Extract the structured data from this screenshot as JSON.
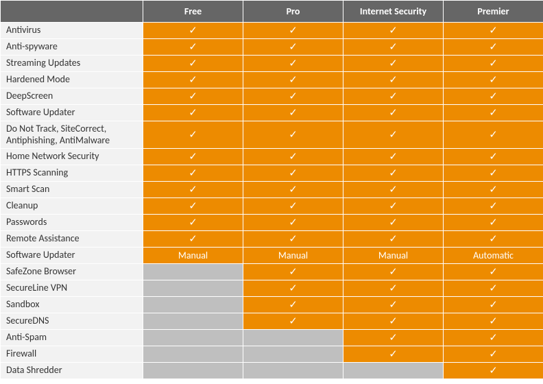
{
  "columns": [
    "Free",
    "Pro",
    "Internet Security",
    "Premier"
  ],
  "check_glyph": "✓",
  "manual_label": "Manual",
  "automatic_label": "Automatic",
  "rows": [
    {
      "feature": "Antivirus",
      "cells": [
        "check",
        "check",
        "check",
        "check"
      ]
    },
    {
      "feature": "Anti-spyware",
      "cells": [
        "check",
        "check",
        "check",
        "check"
      ]
    },
    {
      "feature": "Streaming Updates",
      "cells": [
        "check",
        "check",
        "check",
        "check"
      ]
    },
    {
      "feature": "Hardened Mode",
      "cells": [
        "check",
        "check",
        "check",
        "check"
      ]
    },
    {
      "feature": "DeepScreen",
      "cells": [
        "check",
        "check",
        "check",
        "check"
      ]
    },
    {
      "feature": "Software Updater",
      "cells": [
        "check",
        "check",
        "check",
        "check"
      ]
    },
    {
      "feature": "Do Not Track, SiteCorrect, Antiphishing, AntiMalware",
      "wrap": true,
      "cells": [
        "check",
        "check",
        "check",
        "check"
      ]
    },
    {
      "feature": "Home Network Security",
      "cells": [
        "check",
        "check",
        "check",
        "check"
      ]
    },
    {
      "feature": "HTTPS Scanning",
      "cells": [
        "check",
        "check",
        "check",
        "check"
      ]
    },
    {
      "feature": "Smart Scan",
      "cells": [
        "check",
        "check",
        "check",
        "check"
      ]
    },
    {
      "feature": "Cleanup",
      "cells": [
        "check",
        "check",
        "check",
        "check"
      ]
    },
    {
      "feature": "Passwords",
      "cells": [
        "check",
        "check",
        "check",
        "check"
      ]
    },
    {
      "feature": "Remote Assistance",
      "cells": [
        "check",
        "check",
        "check",
        "check"
      ]
    },
    {
      "feature": "Software Updater",
      "cells": [
        "manual",
        "manual",
        "manual",
        "automatic"
      ]
    },
    {
      "feature": "SafeZone Browser",
      "cells": [
        "off",
        "check",
        "check",
        "check"
      ]
    },
    {
      "feature": "SecureLine VPN",
      "cells": [
        "off",
        "check",
        "check",
        "check"
      ]
    },
    {
      "feature": "Sandbox",
      "cells": [
        "off",
        "check",
        "check",
        "check"
      ]
    },
    {
      "feature": "SecureDNS",
      "cells": [
        "off",
        "check",
        "check",
        "check"
      ]
    },
    {
      "feature": "Anti-Spam",
      "cells": [
        "off",
        "off",
        "check",
        "check"
      ]
    },
    {
      "feature": "Firewall",
      "cells": [
        "off",
        "off",
        "check",
        "check"
      ]
    },
    {
      "feature": "Data Shredder",
      "cells": [
        "off",
        "off",
        "off",
        "check"
      ]
    }
  ]
}
